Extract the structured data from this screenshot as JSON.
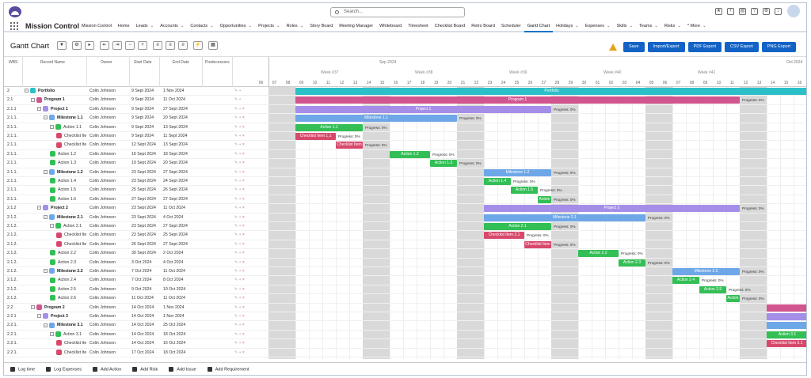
{
  "app": {
    "name": "Mission Control",
    "search_placeholder": "Search..."
  },
  "nav": {
    "items": [
      {
        "label": "Mission Control",
        "chev": false
      },
      {
        "label": "Home",
        "chev": false
      },
      {
        "label": "Leads",
        "chev": true
      },
      {
        "label": "Accounts",
        "chev": true
      },
      {
        "label": "Contacts",
        "chev": true
      },
      {
        "label": "Opportunities",
        "chev": true
      },
      {
        "label": "Projects",
        "chev": true
      },
      {
        "label": "Roles",
        "chev": true
      },
      {
        "label": "Story Board",
        "chev": false
      },
      {
        "label": "Meeting Manager",
        "chev": false
      },
      {
        "label": "Whiteboard",
        "chev": false
      },
      {
        "label": "Timesheet",
        "chev": false
      },
      {
        "label": "Checklist Board",
        "chev": false
      },
      {
        "label": "Retro Board",
        "chev": false
      },
      {
        "label": "Scheduler",
        "chev": false
      },
      {
        "label": "Gantt Chart",
        "chev": false,
        "active": true
      },
      {
        "label": "Holidays",
        "chev": true
      },
      {
        "label": "Expenses",
        "chev": true
      },
      {
        "label": "Skills",
        "chev": true
      },
      {
        "label": "Teams",
        "chev": true
      },
      {
        "label": "Risks",
        "chev": true
      },
      {
        "label": "* More",
        "chev": true
      }
    ]
  },
  "page": {
    "title": "Gantt Chart"
  },
  "toolbar": {
    "icons": [
      "filter-icon",
      "settings-icon",
      "expand-icon",
      "indent-left-icon",
      "indent-right-icon",
      "zoom-out-icon",
      "zoom-in-icon",
      "align-left-icon",
      "align-center-icon",
      "align-right-icon",
      "lightning-icon",
      "calendar-icon"
    ],
    "glyphs": [
      "▼",
      "⚙",
      "▸",
      "⇤",
      "⇥",
      "−",
      "+",
      "≡",
      "≡",
      "≡",
      "⚡",
      "▦"
    ]
  },
  "actions": [
    "Save",
    "Import/Export",
    "PDF Export",
    "CSV Export",
    "PNG Export"
  ],
  "grid": {
    "headers": {
      "wbs": "WBS",
      "name": "Record Name",
      "owner": "Owner",
      "start": "Start Date",
      "end": "End Date",
      "pred": "Predecessors"
    },
    "months": [
      {
        "label": "Sep 2024"
      },
      {
        "label": "Oct 2024"
      }
    ],
    "weeks": [
      "Week #37",
      "Week #38",
      "Week #39",
      "Week #40",
      "Week #41"
    ],
    "days": [
      "06",
      "07",
      "08",
      "09",
      "10",
      "11",
      "12",
      "13",
      "14",
      "15",
      "16",
      "17",
      "18",
      "19",
      "20",
      "21",
      "22",
      "23",
      "24",
      "25",
      "26",
      "27",
      "28",
      "29",
      "30",
      "01",
      "02",
      "03",
      "04",
      "05",
      "06",
      "07",
      "08",
      "09",
      "10",
      "11",
      "12",
      "13",
      "14",
      "15",
      "16"
    ],
    "progress_label": "Progress: 0%",
    "rows": [
      {
        "wbs": "2",
        "name": "Portfolio",
        "owner": "Colin Johnson",
        "start": "9 Sept 2024",
        "end": "1 Nov 2024",
        "indent": 0,
        "type": "portfolio",
        "bold": true,
        "bar": {
          "label": "Portfolio",
          "color": "#2bc0c8"
        }
      },
      {
        "wbs": "2.1",
        "name": "Program 1",
        "owner": "Colin Johnson",
        "start": "9 Sept 2024",
        "end": "11 Oct 2024",
        "indent": 1,
        "type": "program",
        "bold": true,
        "bar": {
          "label": "Program 1",
          "color": "#d1558f"
        }
      },
      {
        "wbs": "2.1.1",
        "name": "Project 1",
        "owner": "Colin Johnson",
        "start": "9 Sept 2024",
        "end": "27 Sept 2024",
        "indent": 2,
        "type": "project",
        "bold": true,
        "bar": {
          "label": "Project 1",
          "color": "#a58ee8"
        }
      },
      {
        "wbs": "2.1.1.",
        "name": "Milestone 1.1",
        "owner": "Colin Johnson",
        "start": "9 Sept 2024",
        "end": "20 Sept 2024",
        "indent": 3,
        "type": "milestone",
        "bold": true,
        "bar": {
          "label": "Milestone 1.1",
          "color": "#6ea7e8"
        }
      },
      {
        "wbs": "2.1.1.",
        "name": "Action 1.1",
        "owner": "Colin Johnson",
        "start": "9 Sept 2024",
        "end": "13 Sept 2024",
        "indent": 4,
        "type": "action",
        "bar": {
          "label": "Action 1.1",
          "color": "#33bf55"
        }
      },
      {
        "wbs": "2.1.1.",
        "name": "Checklist Ite",
        "owner": "Colin Johnson",
        "start": "9 Sept 2024",
        "end": "11 Sept 2024",
        "indent": 5,
        "type": "checklist",
        "bar": {
          "label": "Checklist Item 1.1",
          "color": "#d8486b"
        }
      },
      {
        "wbs": "2.1.1.",
        "name": "Checklist Ite",
        "owner": "Colin Johnson",
        "start": "12 Sept 2024",
        "end": "13 Sept 2024",
        "indent": 5,
        "type": "checklist",
        "bar": {
          "label": "Checklist Item",
          "color": "#d8486b"
        }
      },
      {
        "wbs": "2.1.1.",
        "name": "Action 1.2",
        "owner": "Colin Johnson",
        "start": "16 Sept 2024",
        "end": "18 Sept 2024",
        "indent": 4,
        "type": "action",
        "bar": {
          "label": "Action 1.2",
          "color": "#33bf55"
        }
      },
      {
        "wbs": "2.1.1.",
        "name": "Action 1.3",
        "owner": "Colin Johnson",
        "start": "19 Sept 2024",
        "end": "20 Sept 2024",
        "indent": 4,
        "type": "action",
        "bar": {
          "label": "Action 1.3",
          "color": "#33bf55"
        }
      },
      {
        "wbs": "2.1.1.",
        "name": "Milestone 1.2",
        "owner": "Colin Johnson",
        "start": "23 Sept 2024",
        "end": "27 Sept 2024",
        "indent": 3,
        "type": "milestone",
        "bold": true,
        "bar": {
          "label": "Milestone 1.2",
          "color": "#6ea7e8"
        }
      },
      {
        "wbs": "2.1.1.",
        "name": "Action 1.4",
        "owner": "Colin Johnson",
        "start": "23 Sept 2024",
        "end": "24 Sept 2024",
        "indent": 4,
        "type": "action",
        "bar": {
          "label": "Action 1.4",
          "color": "#33bf55"
        }
      },
      {
        "wbs": "2.1.1.",
        "name": "Action 1.5",
        "owner": "Colin Johnson",
        "start": "25 Sept 2024",
        "end": "26 Sept 2024",
        "indent": 4,
        "type": "action",
        "bar": {
          "label": "Action 1.5",
          "color": "#33bf55"
        }
      },
      {
        "wbs": "2.1.1.",
        "name": "Action 1.6",
        "owner": "Colin Johnson",
        "start": "27 Sept 2024",
        "end": "27 Sept 2024",
        "indent": 4,
        "type": "action",
        "bar": {
          "label": "Action",
          "color": "#33bf55"
        }
      },
      {
        "wbs": "2.1.2",
        "name": "Project 2",
        "owner": "Colin Johnson",
        "start": "23 Sept 2024",
        "end": "11 Oct 2024",
        "indent": 2,
        "type": "project",
        "bold": true,
        "bar": {
          "label": "Project 2",
          "color": "#a58ee8"
        }
      },
      {
        "wbs": "2.1.2.",
        "name": "Milestone 2.1",
        "owner": "Colin Johnson",
        "start": "23 Sept 2024",
        "end": "4 Oct 2024",
        "indent": 3,
        "type": "milestone",
        "bold": true,
        "bar": {
          "label": "Milestone 2.1",
          "color": "#6ea7e8"
        }
      },
      {
        "wbs": "2.1.2.",
        "name": "Action 2.1",
        "owner": "Colin Johnson",
        "start": "23 Sept 2024",
        "end": "27 Sept 2024",
        "indent": 4,
        "type": "action",
        "bar": {
          "label": "Action 2.1",
          "color": "#33bf55"
        }
      },
      {
        "wbs": "2.1.2.",
        "name": "Checklist Ite",
        "owner": "Colin Johnson",
        "start": "23 Sept 2024",
        "end": "25 Sept 2024",
        "indent": 5,
        "type": "checklist",
        "bar": {
          "label": "Checklist Item 2.1",
          "color": "#d8486b"
        }
      },
      {
        "wbs": "2.1.2.",
        "name": "Checklist Ite",
        "owner": "Colin Johnson",
        "start": "26 Sept 2024",
        "end": "27 Sept 2024",
        "indent": 5,
        "type": "checklist",
        "bar": {
          "label": "Checklist Item",
          "color": "#d8486b"
        }
      },
      {
        "wbs": "2.1.2.",
        "name": "Action 2.2",
        "owner": "Colin Johnson",
        "start": "30 Sept 2024",
        "end": "2 Oct 2024",
        "indent": 4,
        "type": "action",
        "bar": {
          "label": "Action 2.2",
          "color": "#33bf55"
        }
      },
      {
        "wbs": "2.1.2.",
        "name": "Action 2.3",
        "owner": "Colin Johnson",
        "start": "3 Oct 2024",
        "end": "4 Oct 2024",
        "indent": 4,
        "type": "action",
        "bar": {
          "label": "Action 2.3",
          "color": "#33bf55"
        }
      },
      {
        "wbs": "2.1.2.",
        "name": "Milestone 2.2",
        "owner": "Colin Johnson",
        "start": "7 Oct 2024",
        "end": "11 Oct 2024",
        "indent": 3,
        "type": "milestone",
        "bold": true,
        "bar": {
          "label": "Milestone 2.2",
          "color": "#6ea7e8"
        }
      },
      {
        "wbs": "2.1.2.",
        "name": "Action 2.4",
        "owner": "Colin Johnson",
        "start": "7 Oct 2024",
        "end": "8 Oct 2024",
        "indent": 4,
        "type": "action",
        "bar": {
          "label": "Action 2.4",
          "color": "#33bf55"
        }
      },
      {
        "wbs": "2.1.2.",
        "name": "Action 2.5",
        "owner": "Colin Johnson",
        "start": "9 Oct 2024",
        "end": "10 Oct 2024",
        "indent": 4,
        "type": "action",
        "bar": {
          "label": "Action 2.5",
          "color": "#33bf55"
        }
      },
      {
        "wbs": "2.1.2.",
        "name": "Action 2.6",
        "owner": "Colin Johnson",
        "start": "11 Oct 2024",
        "end": "11 Oct 2024",
        "indent": 4,
        "type": "action",
        "bar": {
          "label": "Action",
          "color": "#33bf55"
        }
      },
      {
        "wbs": "2.2",
        "name": "Program 2",
        "owner": "Colin Johnson",
        "start": "14 Oct 2024",
        "end": "1 Nov 2024",
        "indent": 1,
        "type": "program",
        "bold": true,
        "bar": {
          "label": "",
          "color": "#d1558f"
        }
      },
      {
        "wbs": "2.2.1",
        "name": "Project 3",
        "owner": "Colin Johnson",
        "start": "14 Oct 2024",
        "end": "1 Nov 2024",
        "indent": 2,
        "type": "project",
        "bold": true,
        "bar": {
          "label": "",
          "color": "#a58ee8"
        }
      },
      {
        "wbs": "2.2.1.",
        "name": "Milestone 3.1",
        "owner": "Colin Johnson",
        "start": "14 Oct 2024",
        "end": "25 Oct 2024",
        "indent": 3,
        "type": "milestone",
        "bold": true,
        "bar": {
          "label": "",
          "color": "#6ea7e8"
        }
      },
      {
        "wbs": "2.2.1.",
        "name": "Action 3.1",
        "owner": "Colin Johnson",
        "start": "14 Oct 2024",
        "end": "18 Oct 2024",
        "indent": 4,
        "type": "action",
        "bar": {
          "label": "Action 3.1",
          "color": "#33bf55"
        }
      },
      {
        "wbs": "2.2.1.",
        "name": "Checklist Ite",
        "owner": "Colin Johnson",
        "start": "14 Oct 2024",
        "end": "16 Oct 2024",
        "indent": 5,
        "type": "checklist",
        "bar": {
          "label": "Checklist Item 3.1",
          "color": "#d8486b"
        }
      },
      {
        "wbs": "2.2.1.",
        "name": "Checklist Ite",
        "owner": "Colin Johnson",
        "start": "17 Oct 2024",
        "end": "18 Oct 2024",
        "indent": 5,
        "type": "checklist",
        "bar": {
          "label": "C",
          "color": "#d8486b"
        }
      }
    ]
  },
  "type_colors": {
    "portfolio": "#2bc0c8",
    "program": "#d1558f",
    "project": "#a58ee8",
    "milestone": "#6ea7e8",
    "action": "#33bf55",
    "checklist": "#d8486b"
  },
  "footer": [
    {
      "label": "Log time",
      "icon": "clock-icon"
    },
    {
      "label": "Log Expenses",
      "icon": "receipt-icon"
    },
    {
      "label": "Add Action",
      "icon": "add-action-icon"
    },
    {
      "label": "Add Risk",
      "icon": "add-risk-icon"
    },
    {
      "label": "Add Issue",
      "icon": "add-issue-icon"
    },
    {
      "label": "Add Requirement",
      "icon": "add-requirement-icon"
    }
  ]
}
